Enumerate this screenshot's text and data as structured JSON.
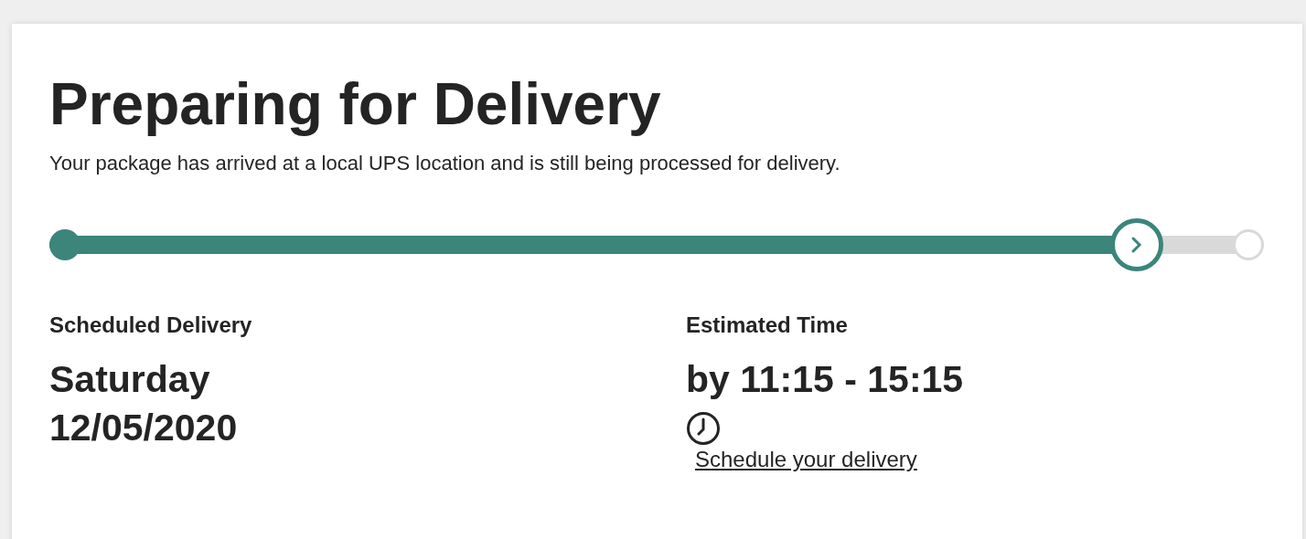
{
  "status": {
    "title": "Preparing for Delivery",
    "description": "Your package has arrived at a local UPS location and is still being processed for delivery."
  },
  "progress": {
    "level": 0.895
  },
  "details": [
    {
      "label": "Scheduled Delivery",
      "value_lines": [
        "Saturday",
        "12/05/2020"
      ]
    },
    {
      "label": "Estimated Time",
      "value_lines": [
        "by 11:15 - 15:15"
      ],
      "link": "Schedule your delivery"
    }
  ]
}
